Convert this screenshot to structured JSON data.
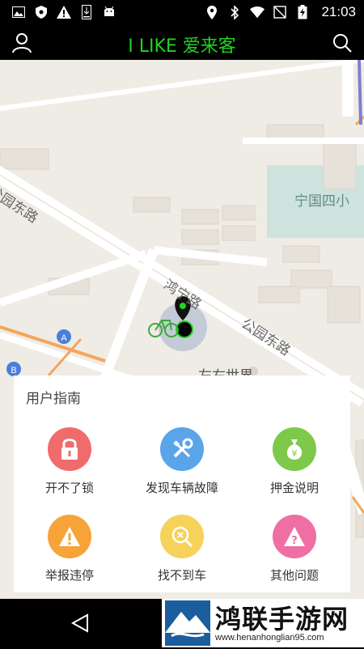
{
  "status_bar": {
    "time": "21:03"
  },
  "app_bar": {
    "title": "I LIKE 爱来客"
  },
  "map": {
    "labels": {
      "road_gongyuan_east_1": "公园东路",
      "road_hongning": "鸿宁路",
      "road_gongyuan_east_2": "公园东路",
      "school": "宁国四小",
      "poi_zuoyou": "左右世界",
      "marker_a": "A",
      "marker_b": "B"
    }
  },
  "guide": {
    "title": "用户指南",
    "items": [
      {
        "label": "开不了锁",
        "color": "#f06b6b",
        "icon": "lock-icon"
      },
      {
        "label": "发现车辆故障",
        "color": "#5aa4ea",
        "icon": "wrench-screwdriver-icon"
      },
      {
        "label": "押金说明",
        "color": "#7ec84a",
        "icon": "money-bag-icon"
      },
      {
        "label": "举报违停",
        "color": "#f6a33a",
        "icon": "warning-icon"
      },
      {
        "label": "找不到车",
        "color": "#f7d25a",
        "icon": "search-bike-icon"
      },
      {
        "label": "其他问题",
        "color": "#ef6fa2",
        "icon": "question-icon"
      }
    ]
  },
  "watermark": {
    "title": "鸿联手游网",
    "url": "www.henanhonglian95.com"
  }
}
